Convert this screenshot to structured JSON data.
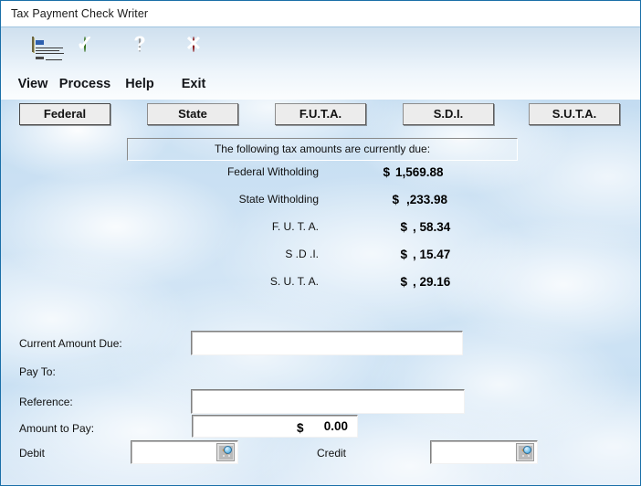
{
  "window": {
    "title": "Tax Payment Check Writer"
  },
  "toolbar": {
    "buttons": [
      {
        "label": "View",
        "icon": "check-document-icon"
      },
      {
        "label": "Process",
        "icon": "green-check-circle-icon"
      },
      {
        "label": "Help",
        "icon": "blue-question-circle-icon"
      },
      {
        "label": "Exit",
        "icon": "red-x-circle-icon"
      }
    ]
  },
  "tabs": [
    {
      "label": "Federal",
      "active": true
    },
    {
      "label": "State",
      "active": false
    },
    {
      "label": "F.U.T.A.",
      "active": false
    },
    {
      "label": "S.D.I.",
      "active": false
    },
    {
      "label": "S.U.T.A.",
      "active": false
    }
  ],
  "banner": {
    "text": "The following tax amounts are currently due:"
  },
  "tax_due": {
    "currency_symbol": "$",
    "rows": [
      {
        "label": "Federal Witholding",
        "amount": "1,569.88"
      },
      {
        "label": "State Witholding",
        "amount": ",233.98"
      },
      {
        "label": "F. U. T. A.",
        "amount": ", 58.34"
      },
      {
        "label": "S .D .I.",
        "amount": ", 15.47"
      },
      {
        "label": "S. U. T. A.",
        "amount": ", 29.16"
      }
    ]
  },
  "form": {
    "current_amount_due": {
      "label": "Current Amount Due:",
      "value": "",
      "placeholder": ""
    },
    "pay_to": {
      "label": "Pay To:",
      "value": ""
    },
    "reference": {
      "label": "Reference:",
      "value": "",
      "placeholder": ""
    },
    "amount_to_pay": {
      "label": "Amount to Pay:",
      "currency_symbol": "$",
      "value": "0.00"
    },
    "debit": {
      "label": "Debit",
      "value": "",
      "lookup_icon": "magnifier-lookup-icon"
    },
    "credit": {
      "label": "Credit",
      "value": "",
      "lookup_icon": "magnifier-lookup-icon"
    }
  },
  "colors": {
    "window_border": "#1a6fa8",
    "sky_background": "#c3dcf1",
    "button_face": "#ececec",
    "accent_green": "#56bd1e",
    "accent_blue": "#1f49b6",
    "accent_red": "#d01f1f"
  }
}
